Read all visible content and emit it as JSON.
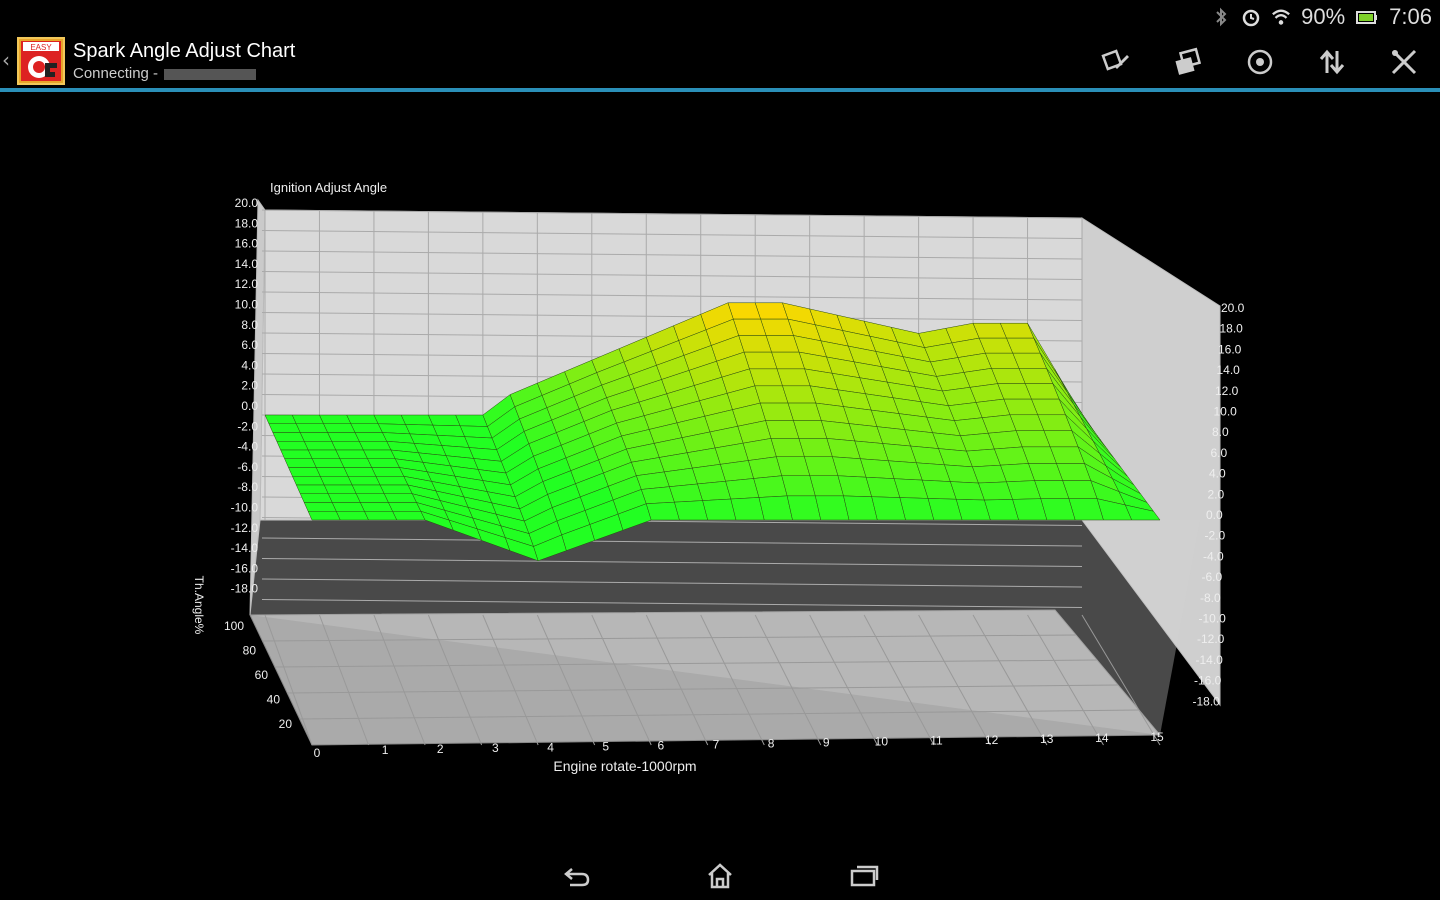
{
  "status": {
    "battery": "90%",
    "time": "7:06",
    "icons": [
      "bluetooth-icon",
      "alarm-icon",
      "wifi-icon",
      "battery-icon"
    ]
  },
  "app": {
    "title": "Spark Angle Adjust Chart",
    "subtitle": "Connecting -",
    "logo_text": "EASY",
    "accent_color": "#2a8fb8",
    "actions": [
      {
        "name": "edit-icon",
        "label": "Edit"
      },
      {
        "name": "copy-icon",
        "label": "Copy"
      },
      {
        "name": "target-icon",
        "label": "Target"
      },
      {
        "name": "sort-icon",
        "label": "Sort"
      },
      {
        "name": "tools-icon",
        "label": "Tools"
      }
    ]
  },
  "navbar": {
    "buttons": [
      "back-icon",
      "home-icon",
      "recent-apps-icon"
    ]
  },
  "chart_data": {
    "type": "surface3d",
    "title": "Ignition Adjust Angle",
    "xlabel": "Engine rotate-1000rpm",
    "ylabel": "Th.Angle%",
    "x_ticks": [
      "0",
      "1",
      "2",
      "3",
      "4",
      "5",
      "6",
      "7",
      "8",
      "9",
      "10",
      "11",
      "12",
      "13",
      "14",
      "15"
    ],
    "y_ticks": [
      "20",
      "40",
      "60",
      "80",
      "100"
    ],
    "z_ticks_left": [
      "20.0",
      "18.0",
      "16.0",
      "14.0",
      "12.0",
      "10.0",
      "8.0",
      "6.0",
      "4.0",
      "2.0",
      "0.0",
      "-2.0",
      "-4.0",
      "-6.0",
      "-8.0",
      "-10.0",
      "-12.0",
      "-14.0",
      "-16.0",
      "-18.0"
    ],
    "z_ticks_right": [
      "20.0",
      "18.0",
      "16.0",
      "14.0",
      "12.0",
      "10.0",
      "8.0",
      "6.0",
      "4.0",
      "2.0",
      "0.0",
      "-2.0",
      "-4.0",
      "-6.0",
      "-8.0",
      "-10.0",
      "-12.0",
      "-14.0",
      "-16.0",
      "-18.0"
    ],
    "zlim": [
      -18,
      20
    ],
    "colors": {
      "low": "#22ff22",
      "high": "#ffd700"
    },
    "back_row_profile_x": [
      0,
      4,
      4.5,
      8.5,
      9.5,
      12,
      13,
      14,
      15
    ],
    "back_row_profile_z": [
      0,
      0,
      2,
      11,
      11,
      8,
      9,
      9,
      0
    ],
    "front_row_z": 0,
    "front_row_dip": {
      "x": 4,
      "z": -4
    }
  }
}
